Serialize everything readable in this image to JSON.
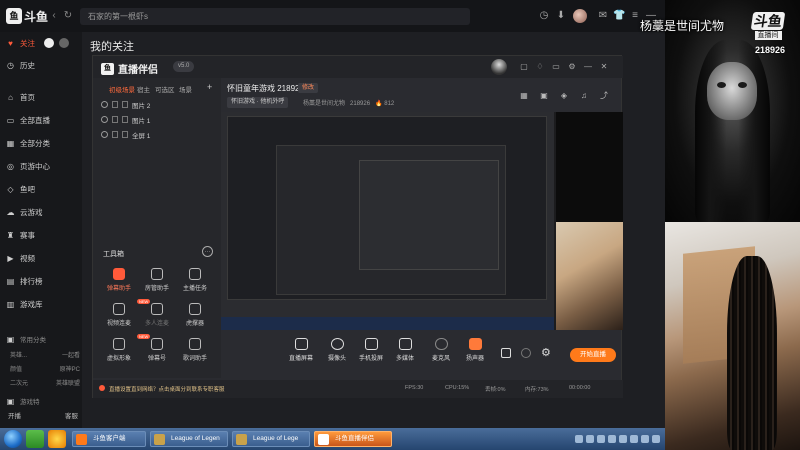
{
  "browser": {
    "logo": "斗鱼",
    "url": "石家的第一根虾s",
    "nav": [
      "back-icon",
      "forward-icon",
      "refresh-icon"
    ]
  },
  "page": {
    "title": "我的关注"
  },
  "leftnav": {
    "items": [
      {
        "label": "关注",
        "icon": "heart-icon",
        "active": true
      },
      {
        "label": "历史",
        "icon": "clock-icon"
      },
      {
        "label": "首页",
        "icon": "home-icon"
      },
      {
        "label": "全部直播",
        "icon": "tv-icon"
      },
      {
        "label": "全部分类",
        "icon": "grid-icon"
      },
      {
        "label": "页游中心",
        "icon": "gamepad-icon"
      },
      {
        "label": "鱼吧",
        "icon": "fish-icon"
      },
      {
        "label": "云游戏",
        "icon": "cloud-icon"
      },
      {
        "label": "赛事",
        "icon": "trophy-icon"
      },
      {
        "label": "视频",
        "icon": "video-icon"
      },
      {
        "label": "排行榜",
        "icon": "rank-icon"
      },
      {
        "label": "游戏库",
        "icon": "library-icon"
      }
    ],
    "section": "常用分类",
    "sub_rows": [
      [
        "英雄...",
        "一起看"
      ],
      [
        "颜值",
        "原神PC"
      ],
      [
        "二次元",
        "英雄联盟"
      ]
    ],
    "section2": "游戏特",
    "bottom": [
      "开播",
      "客服"
    ]
  },
  "companion": {
    "logo": "直播伴侣",
    "version": "v5.0",
    "scene_tabs": [
      "初级场景",
      "宿主",
      "可选区",
      "场景"
    ],
    "scenes": [
      "图片 2",
      "图片 1",
      "全屏 1"
    ],
    "tools_title": "工具箱",
    "tools": [
      {
        "label": "弹幕助手",
        "red": true,
        "badge": ""
      },
      {
        "label": "房管助手",
        "badge": ""
      },
      {
        "label": "主播任务",
        "badge": ""
      },
      {
        "label": "视频连麦",
        "badge": "NEW"
      },
      {
        "label": "多人连麦",
        "badge": ""
      },
      {
        "label": "虎撑器",
        "badge": ""
      },
      {
        "label": "虚拟形象",
        "badge": "NEW"
      },
      {
        "label": "弹幕号",
        "badge": ""
      },
      {
        "label": "歌词助手",
        "badge": ""
      }
    ],
    "stream_title": "怀旧童年游戏 218926",
    "stream_tag": "修改",
    "category": "怀旧游戏 · 他机外呼",
    "meta_name": "杨藁是世间尤物",
    "meta_room": "218926",
    "meta_heat": "812",
    "controls": [
      {
        "label": "直播屏幕",
        "icon": "screen-icon"
      },
      {
        "label": "摄像头",
        "icon": "camera-icon"
      },
      {
        "label": "手机投屏",
        "icon": "phone-icon"
      },
      {
        "label": "多媒体",
        "icon": "media-icon"
      },
      {
        "label": "麦克风",
        "icon": "mic-icon"
      },
      {
        "label": "扬声器",
        "icon": "speaker-icon"
      }
    ],
    "start_label": "开始直播",
    "status_warn": "直播设置直到网络？点击桌面分到联系专职客服",
    "status_stats": [
      "FPS:30",
      "CPU:15%",
      "丢帧:0%",
      "内存:73%",
      "00:00:00"
    ]
  },
  "taskbar": {
    "tasks": [
      {
        "label": "斗鱼客户端",
        "on": false
      },
      {
        "label": "League of Legen",
        "on": false
      },
      {
        "label": "League of Lege",
        "on": false
      },
      {
        "label": "斗鱼直播伴侣",
        "on": true
      }
    ]
  },
  "overlay": {
    "streamer_name": "杨藁是世间尤物",
    "badge_big": "斗鱼",
    "badge_small": "直播间",
    "room": "218926"
  }
}
